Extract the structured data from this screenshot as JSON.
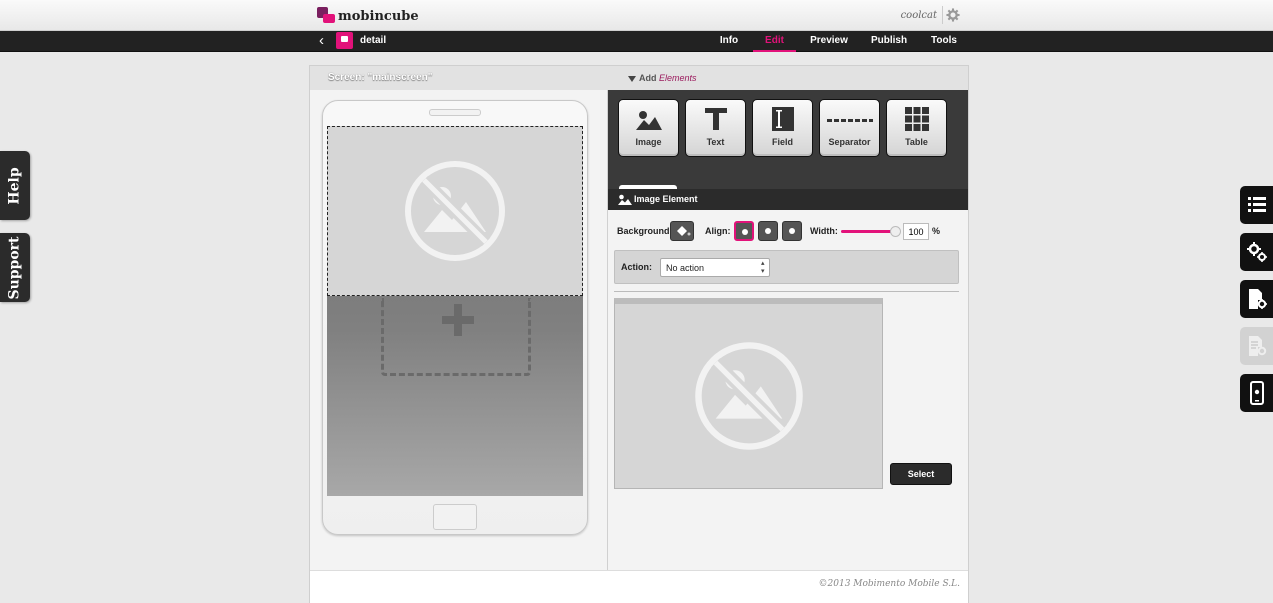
{
  "brand": {
    "name": "mobincube",
    "accent": "#e2127a"
  },
  "user": {
    "name": "coolcat"
  },
  "app": {
    "name": "detail"
  },
  "nav": {
    "tabs": [
      {
        "label": "Info"
      },
      {
        "label": "Edit"
      },
      {
        "label": "Preview"
      },
      {
        "label": "Publish"
      },
      {
        "label": "Tools"
      }
    ],
    "active": "Edit"
  },
  "side_left": {
    "help": "Help",
    "support": "Support"
  },
  "side_right": [
    {
      "icon": "list-icon"
    },
    {
      "icon": "gears-icon"
    },
    {
      "icon": "document-gear-icon"
    },
    {
      "icon": "document-settings-icon"
    },
    {
      "icon": "mobile-preview-icon"
    }
  ],
  "screen": {
    "title": "Screen: \"mainscreen\""
  },
  "add_elements": {
    "prefix": "Add",
    "label": "Elements"
  },
  "elements": [
    {
      "label": "Image",
      "icon": "image-icon"
    },
    {
      "label": "Text",
      "icon": "text-icon"
    },
    {
      "label": "Field",
      "icon": "field-icon"
    },
    {
      "label": "Separator",
      "icon": "separator-icon"
    },
    {
      "label": "Table",
      "icon": "table-icon"
    }
  ],
  "image_element": {
    "title": "Image Element",
    "background_label": "Background:",
    "align_label": "Align:",
    "width_label": "Width:",
    "width_value": "100",
    "width_unit": "%",
    "action_label": "Action:",
    "action_value": "No action",
    "select_label": "Select"
  },
  "footer": {
    "copyright": "©2013 Mobimento Mobile S.L."
  }
}
